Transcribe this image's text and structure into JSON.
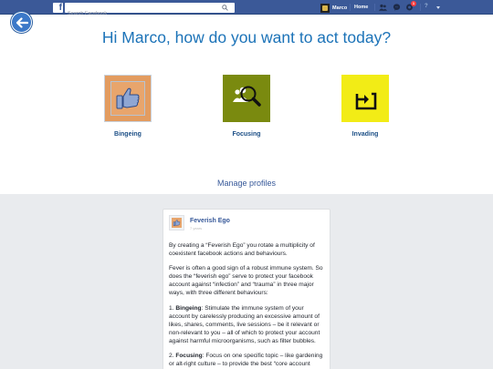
{
  "topbar": {
    "logo_letter": "f",
    "search_placeholder": "Search Facebook",
    "user_name": "Marco",
    "home_label": "Home",
    "notification_count": "1",
    "help_label": "?"
  },
  "hero": {
    "headline": "Hi Marco, how do you want to act today?",
    "actions": [
      {
        "label": "Bingeing",
        "color": "#e39c60",
        "icon": "thumbs-up-icon"
      },
      {
        "label": "Focusing",
        "color": "#7a8a0f",
        "icon": "magnifier-people-icon"
      },
      {
        "label": "Invading",
        "color": "#f2ec16",
        "icon": "share-arrow-icon"
      }
    ],
    "manage_link": "Manage profiles"
  },
  "card": {
    "title": "Feverish Ego",
    "subtitle": "7 years",
    "para1": "By creating a “Feverish Ego” you rotate a multiplicity of coexistent facebook actions and behaviours.",
    "para2": "Fever is often a good sign of a robust immune system. So does the “feverish ego” serve to protect your facebook account against “infection” and “trauma” in three major ways, with three different behaviours:",
    "para3_prefix": "1. ",
    "para3_term": "Bingeing",
    "para3_text": ": Stimulate the immune system of your account by carelessly producing an excessive amount of likes, shares, comments, live sessions – be it relevant or non-relevant to you – all of which to protect your account against harmful microorganisms, such as filter bubbles.",
    "para4_prefix": "2. ",
    "para4_term": "Focusing",
    "para4_text": ": Focus on one specific topic – like gardening or alt-right culture – to provide the best “core account temperature” for invading bacteria and viruses"
  }
}
